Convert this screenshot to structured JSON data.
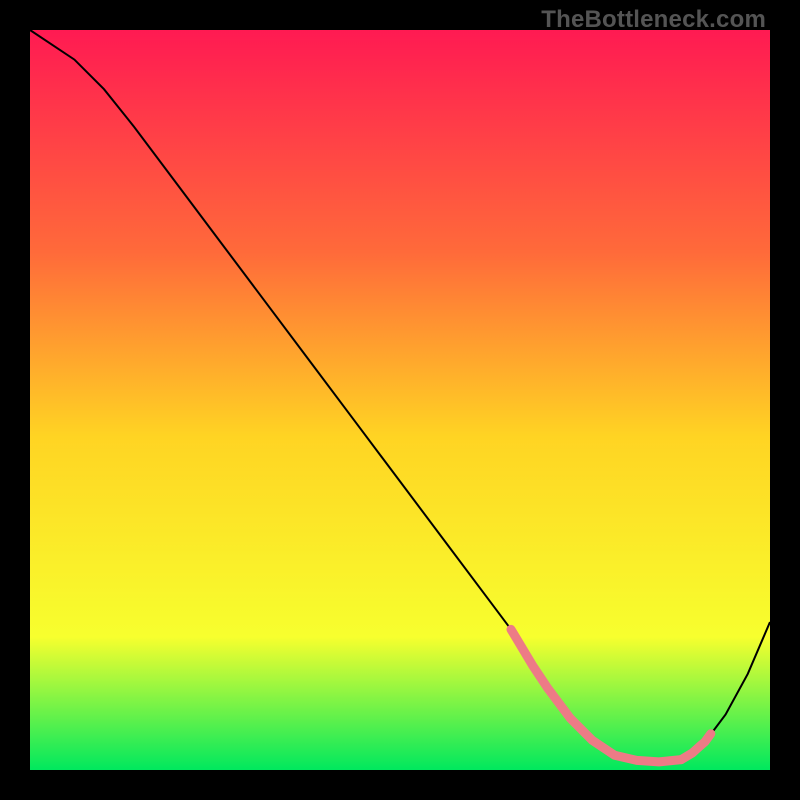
{
  "watermark": {
    "text": "TheBottleneck.com"
  },
  "chart_data": {
    "type": "line",
    "title": "",
    "xlabel": "",
    "ylabel": "",
    "xlim": [
      0,
      100
    ],
    "ylim": [
      0,
      100
    ],
    "grid": false,
    "legend": false,
    "gradient_bg": {
      "top_color": "#ff1a52",
      "mid_upper_color": "#ff6a3a",
      "mid_color": "#ffd423",
      "mid_lower_color": "#f7ff2e",
      "bottom_color": "#00e85e"
    },
    "series": [
      {
        "name": "bottleneck-curve",
        "color": "#000000",
        "stroke_width": 2,
        "x": [
          0,
          6,
          10,
          14,
          20,
          26,
          32,
          38,
          44,
          50,
          56,
          62,
          65,
          68,
          70,
          73,
          76,
          79,
          82,
          85,
          88,
          91,
          94,
          97,
          100
        ],
        "y": [
          100,
          96,
          92,
          87,
          79,
          71,
          63,
          55,
          47,
          39,
          31,
          23,
          19,
          14,
          11,
          7,
          4,
          2,
          1.3,
          1.1,
          1.4,
          3.5,
          7.5,
          13,
          20
        ]
      },
      {
        "name": "optimal-range",
        "color": "#ed7b86",
        "stroke_width": 9,
        "linecap": "round",
        "x": [
          65,
          68,
          70,
          73,
          76,
          79,
          82,
          85,
          88
        ],
        "y": [
          19,
          14,
          11,
          7,
          4,
          2,
          1.3,
          1.1,
          1.4
        ]
      },
      {
        "name": "right-tail-dots",
        "color": "#ed7b86",
        "stroke_width": 9,
        "linecap": "round",
        "x": [
          88,
          89.5,
          90.5,
          91.2,
          92
        ],
        "y": [
          1.4,
          2.3,
          3.2,
          3.8,
          4.9
        ]
      }
    ]
  }
}
